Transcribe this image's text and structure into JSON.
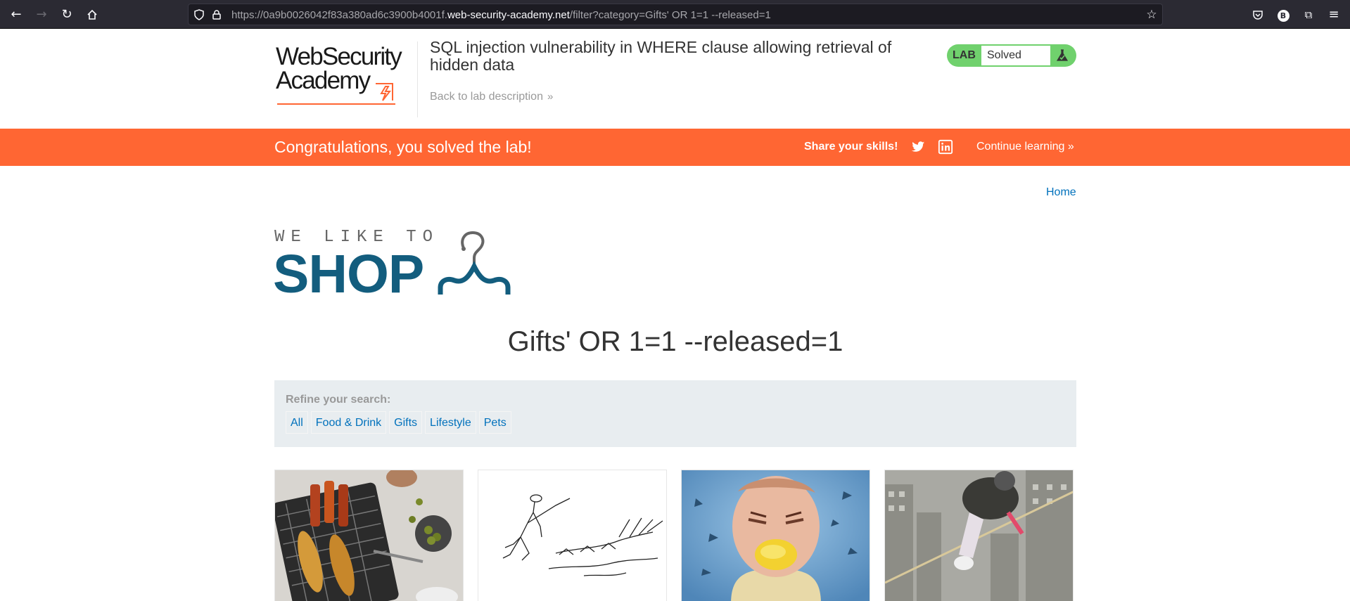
{
  "browser": {
    "url_prefix": "https://0a9b0026042f83a380ad6c3900b4001f.",
    "url_host": "web-security-academy.net",
    "url_path": "/filter?category=Gifts' OR 1=1 --released=1",
    "profile_initial": "B"
  },
  "header": {
    "logo_line1": "WebSecurity",
    "logo_line2": "Academy",
    "lab_title": "SQL injection vulnerability in WHERE clause allowing retrieval of hidden data",
    "back_link": "Back to lab description",
    "badge_label": "LAB",
    "badge_status": "Solved"
  },
  "banner": {
    "message": "Congratulations, you solved the lab!",
    "share": "Share your skills!",
    "continue": "Continue learning"
  },
  "shop": {
    "home": "Home",
    "logo_small": "WE LIKE TO",
    "logo_big": "SHOP",
    "heading": "Gifts' OR 1=1 --released=1",
    "refine_label": "Refine your search:",
    "filters": [
      "All",
      "Food & Drink",
      "Gifts",
      "Lifestyle",
      "Pets"
    ]
  },
  "products": [
    {
      "image": "barbecue-skewers-image"
    },
    {
      "image": "hunting-sketch-image"
    },
    {
      "image": "lemon-face-image"
    },
    {
      "image": "skyscraper-tightrope-image"
    }
  ],
  "colors": {
    "brand_orange": "#ff6633",
    "link_blue": "#0071bc",
    "shop_blue": "#135d7e",
    "solved_green": "#70d16d"
  }
}
